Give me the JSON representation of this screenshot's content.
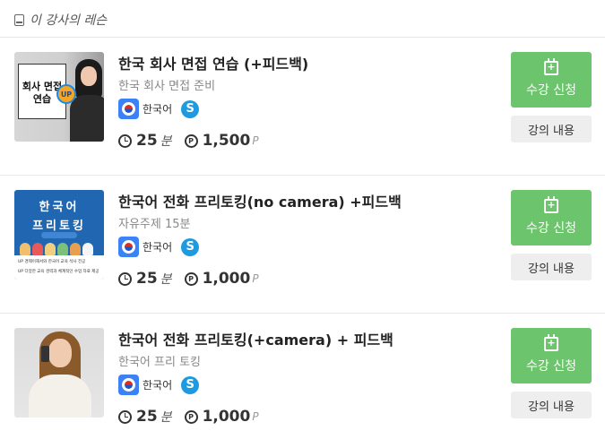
{
  "section": {
    "title": "이 강사의 레슨",
    "icon": "book-icon"
  },
  "buttons": {
    "enroll": "수강 신청",
    "detail": "강의 내용"
  },
  "lessons": [
    {
      "title": "한국 회사 면접 연습 (+피드백)",
      "subtitle": "한국 회사 면접 준비",
      "language": "한국어",
      "duration": "25",
      "duration_unit": "분",
      "price": "1,500",
      "price_unit": "P",
      "thumb": {
        "card_line1": "회사 면접",
        "card_line2": "연습",
        "badge": "UP"
      }
    },
    {
      "title": "한국어 전화 프리토킹(no camera) +피드백",
      "subtitle": "자유주제 15분",
      "language": "한국어",
      "duration": "25",
      "duration_unit": "분",
      "price": "1,000",
      "price_unit": "P",
      "thumb": {
        "line1": "한국어",
        "line2": "프리토킹",
        "note1": "UP 경제이해서와 한국어 교육 석사 전공",
        "note2": "UP 다양한 교육 경력과 체계적인 수업 자료 제공"
      }
    },
    {
      "title": "한국어 전화 프리토킹(+camera) + 피드백",
      "subtitle": "한국어 프리 토킹",
      "language": "한국어",
      "duration": "25",
      "duration_unit": "분",
      "price": "1,000",
      "price_unit": "P"
    }
  ],
  "colors": {
    "enroll_bg": "#6cc46c",
    "detail_bg": "#eeeeee",
    "flag_bg": "#3b82f6",
    "skype": "#1e9be0"
  }
}
